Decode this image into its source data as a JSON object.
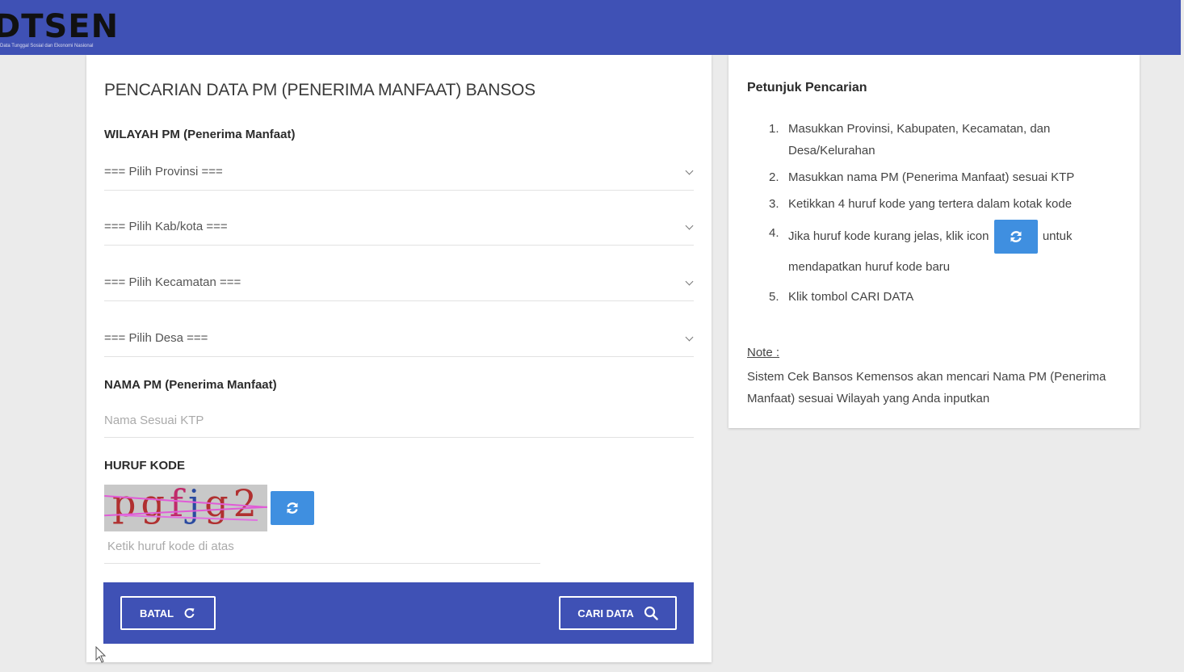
{
  "header": {
    "logo_text": "DTSEN",
    "logo_subtitle": "Data Tunggal Sosial dan Ekonomi Nasional",
    "bg_color": "#3f51b5"
  },
  "form": {
    "title": "PENCARIAN DATA PM (PENERIMA MANFAAT) BANSOS",
    "wilayah_label": "WILAYAH PM (Penerima Manfaat)",
    "selects": {
      "provinsi": "=== Pilih Provinsi ===",
      "kabkota": "=== Pilih Kab/kota ===",
      "kecamatan": "=== Pilih Kecamatan ===",
      "desa": "=== Pilih Desa ==="
    },
    "nama_label": "NAMA PM (Penerima Manfaat)",
    "nama_placeholder": "Nama Sesuai KTP",
    "kode_label": "HURUF KODE",
    "captcha_text": "pgfjg2",
    "captcha_placeholder": "Ketik huruf kode di atas",
    "batal_label": "BATAL",
    "cari_label": "CARI DATA"
  },
  "help": {
    "title": "Petunjuk Pencarian",
    "steps": [
      "Masukkan Provinsi, Kabupaten, Kecamatan, dan Desa/Kelurahan",
      "Masukkan nama PM (Penerima Manfaat) sesuai KTP",
      "Ketikkan 4 huruf kode yang tertera dalam kotak kode",
      "Jika huruf kode kurang jelas, klik icon",
      "Klik tombol CARI DATA"
    ],
    "step4_suffix": "untuk mendapatkan huruf kode baru",
    "step_numbers": [
      "1.",
      "2.",
      "3.",
      "4.",
      "5."
    ],
    "note_label": "Note :",
    "note_text": "Sistem Cek Bansos Kemensos akan mencari Nama PM (Penerima Manfaat) sesuai Wilayah yang Anda inputkan"
  },
  "colors": {
    "accent": "#3f51b5",
    "refresh_button": "#3f8fe0"
  },
  "icons": {
    "refresh": "refresh-icon",
    "search": "search-icon",
    "undo": "undo-icon",
    "chevron": "chevron-down-icon"
  }
}
